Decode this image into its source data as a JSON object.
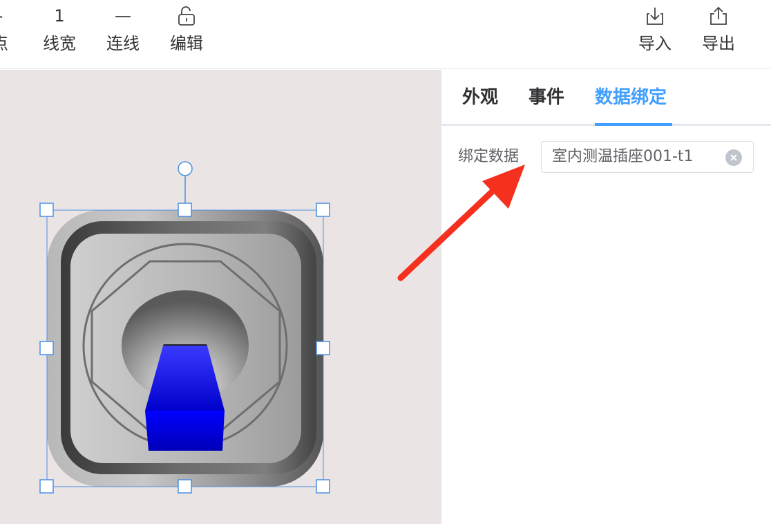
{
  "toolbar": {
    "items": [
      {
        "icon": "dash-icon",
        "icon_text": "-",
        "label": "点"
      },
      {
        "icon": "line-width-icon",
        "icon_text": "1",
        "label": "线宽"
      },
      {
        "icon": "line-style-icon",
        "icon_text": "—",
        "label": "连线"
      },
      {
        "icon": "unlock-icon",
        "icon_text": "",
        "label": "编辑"
      },
      {
        "icon": "import-icon",
        "icon_text": "",
        "label": "导入"
      },
      {
        "icon": "export-icon",
        "icon_text": "",
        "label": "导出"
      }
    ]
  },
  "panel": {
    "tabs": [
      "外观",
      "事件",
      "数据绑定"
    ],
    "active_tab": "数据绑定",
    "binding": {
      "label": "绑定数据",
      "value": "室内测温插座001-t1"
    }
  },
  "colors": {
    "accent": "#409eff",
    "canvas_bg": "#ebe4e4",
    "annotation_arrow": "#f5301e",
    "selection": "#4a90e2",
    "switch_lever": "#0000ff"
  }
}
